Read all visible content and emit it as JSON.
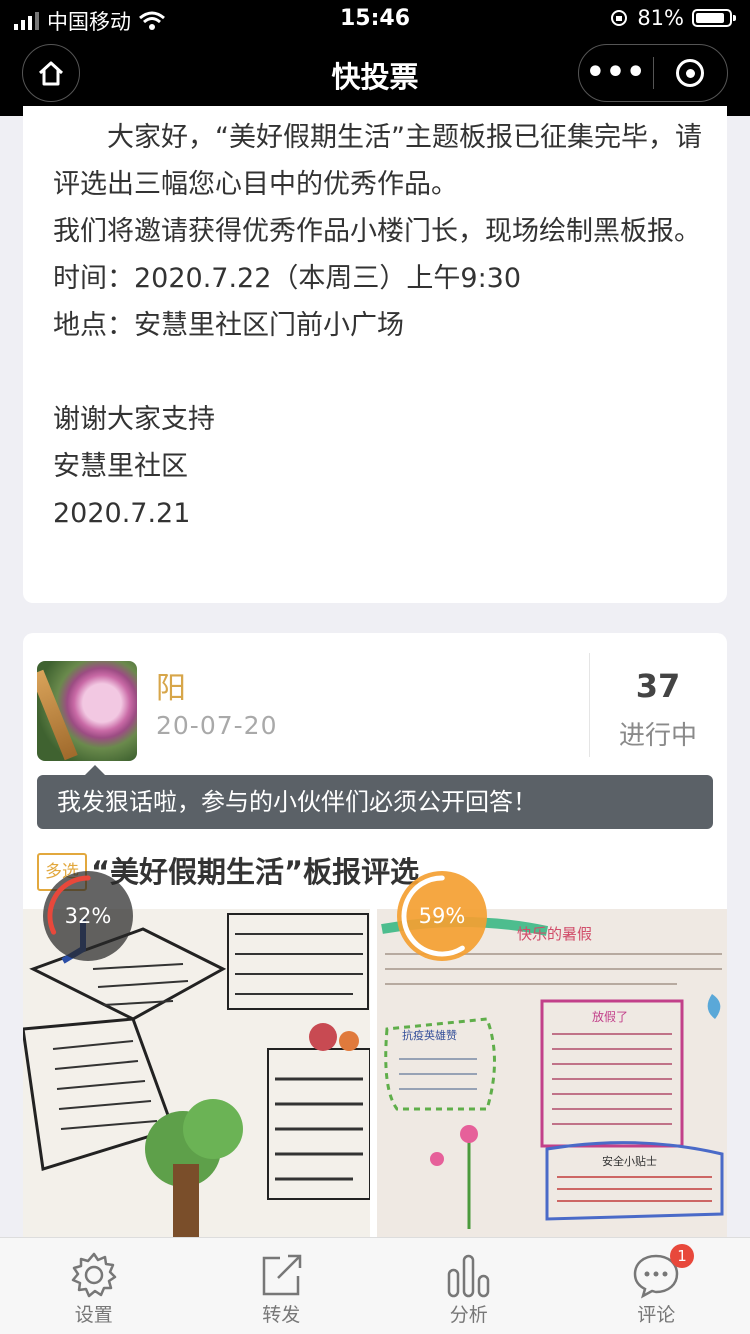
{
  "status_bar": {
    "carrier": "中国移动",
    "time": "15:46",
    "battery": "81%"
  },
  "nav": {
    "title": "快投票"
  },
  "notice": {
    "lines": [
      "大家好，“美好假期生活”主题板报已征集完毕，请评选出三幅您心目中的优秀作品。",
      "我们将邀请获得优秀作品小楼门长，现场绘制黑板报。",
      "时间：2020.7.22（本周三）上午9:30",
      "地点：安慧里社区门前小广场",
      "谢谢大家支持",
      "安慧里社区",
      "2020.7.21"
    ]
  },
  "poll": {
    "author": "阳",
    "date": "20-07-20",
    "count": "37",
    "status": "进行中",
    "message": "我发狠话啦，参与的小伙伴们必须公开回答！",
    "tag": "多选",
    "title": "“美好假期生活”板报评选",
    "options": [
      {
        "percent": "32%",
        "fraction": 0.32,
        "color": "#e8483b"
      },
      {
        "percent": "59%",
        "fraction": 0.59,
        "color": "#ffffff"
      }
    ]
  },
  "poster2": {
    "heading": "快乐的暑假",
    "left_title": "抗疫英雄赞",
    "poem_title": "放假了",
    "tips_title": "安全小贴士"
  },
  "tabbar": {
    "items": [
      {
        "label": "设置",
        "icon": "gear-icon"
      },
      {
        "label": "转发",
        "icon": "share-icon"
      },
      {
        "label": "分析",
        "icon": "chart-icon"
      },
      {
        "label": "评论",
        "icon": "comment-icon",
        "badge": "1"
      }
    ]
  }
}
